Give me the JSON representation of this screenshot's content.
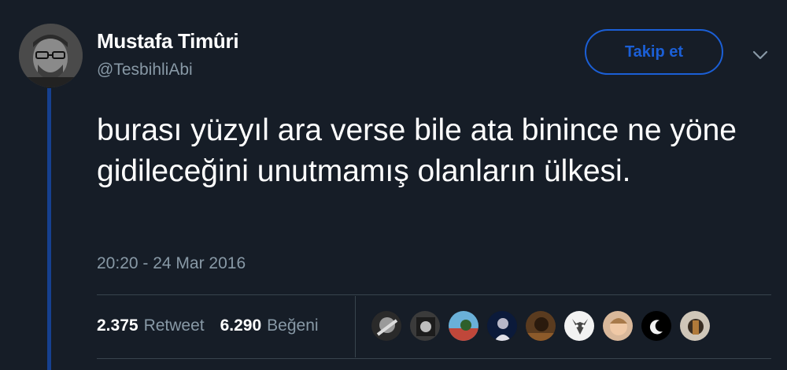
{
  "tweet": {
    "author_name": "Mustafa Timûri",
    "author_handle": "@TesbihliAbi",
    "follow_label": "Takip et",
    "text": "burası yüzyıl ara verse bile ata binince ne yöne gidileceğini unutmamış olanların ülkesi.",
    "timestamp": "20:20 - 24 Mar 2016",
    "retweet_count": "2.375",
    "retweet_label": "Retweet",
    "like_count": "6.290",
    "like_label": "Beğeni"
  },
  "colors": {
    "background": "#161d27",
    "accent": "#1b5fd6",
    "muted_text": "#8899a6",
    "thread_line": "#16408f"
  },
  "likers_count_shown": 9
}
